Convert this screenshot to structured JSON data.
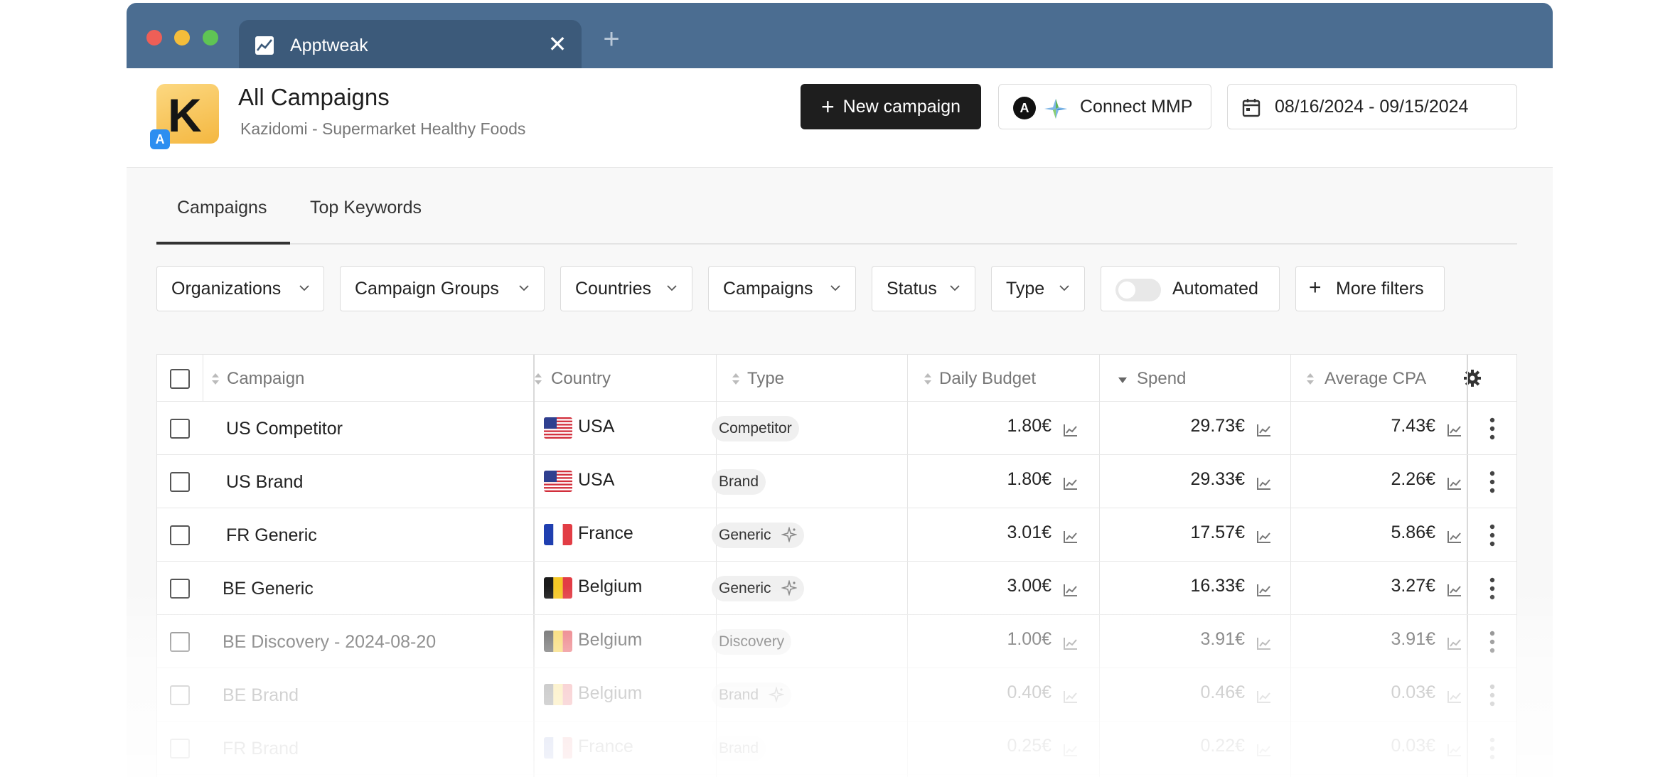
{
  "browser": {
    "tab_title": "Apptweak",
    "close_label": "✕",
    "new_tab_label": "+"
  },
  "header": {
    "app_logo_letter": "K",
    "store_badge": "A",
    "title": "All Campaigns",
    "subtitle": "Kazidomi - Supermarket Healthy Foods",
    "new_campaign_label": "New campaign",
    "connect_mmp_label": "Connect MMP",
    "date_range": "08/16/2024 - 09/15/2024"
  },
  "tabs": [
    {
      "label": "Campaigns",
      "active": true
    },
    {
      "label": "Top Keywords",
      "active": false
    }
  ],
  "filters": [
    {
      "label": "Organizations"
    },
    {
      "label": "Campaign Groups"
    },
    {
      "label": "Countries"
    },
    {
      "label": "Campaigns"
    },
    {
      "label": "Status"
    },
    {
      "label": "Type"
    },
    {
      "label": "Automated",
      "toggle": false
    },
    {
      "label": "More filters"
    }
  ],
  "table": {
    "columns": [
      "Campaign",
      "Country",
      "Type",
      "Daily Budget",
      "Spend",
      "Average CPA"
    ],
    "sorted_column": "Spend",
    "rows": [
      {
        "campaign": "US Competitor",
        "country": "USA",
        "type": "Competitor",
        "automated": false,
        "daily_budget": "1.80€",
        "spend": "29.73€",
        "avg_cpa": "7.43€",
        "flag": "us"
      },
      {
        "campaign": "US Brand",
        "country": "USA",
        "type": "Brand",
        "automated": false,
        "daily_budget": "1.80€",
        "spend": "29.33€",
        "avg_cpa": "2.26€",
        "flag": "us"
      },
      {
        "campaign": "FR Generic",
        "country": "France",
        "type": "Generic",
        "automated": true,
        "daily_budget": "3.01€",
        "spend": "17.57€",
        "avg_cpa": "5.86€",
        "flag": "fr"
      },
      {
        "campaign": "BE Generic",
        "country": "Belgium",
        "type": "Generic",
        "automated": true,
        "daily_budget": "3.00€",
        "spend": "16.33€",
        "avg_cpa": "3.27€",
        "flag": "be"
      },
      {
        "campaign": "BE Discovery - 2024-08-20",
        "country": "Belgium",
        "type": "Discovery",
        "automated": false,
        "daily_budget": "1.00€",
        "spend": "3.91€",
        "avg_cpa": "3.91€",
        "flag": "be"
      },
      {
        "campaign": "BE Brand",
        "country": "Belgium",
        "type": "Brand",
        "automated": true,
        "daily_budget": "0.40€",
        "spend": "0.46€",
        "avg_cpa": "0.03€",
        "flag": "be"
      },
      {
        "campaign": "FR Brand",
        "country": "France",
        "type": "Brand",
        "automated": false,
        "daily_budget": "0.25€",
        "spend": "0.22€",
        "avg_cpa": "0.03€",
        "flag": "fr"
      }
    ]
  },
  "colors": {
    "titlebar": "#4b6d91",
    "tab_active": "#3c5a7a",
    "primary_button": "#1e1e1e",
    "logo_yellow": "#f4b740",
    "store_blue": "#2d8ef0"
  },
  "icons": {
    "tab_favicon": "trend-chart-icon",
    "calendar": "calendar-icon",
    "settings": "gear-icon",
    "row_menu": "kebab-menu-icon",
    "metric_chart": "line-chart-icon",
    "automation": "sparkle-icon"
  }
}
